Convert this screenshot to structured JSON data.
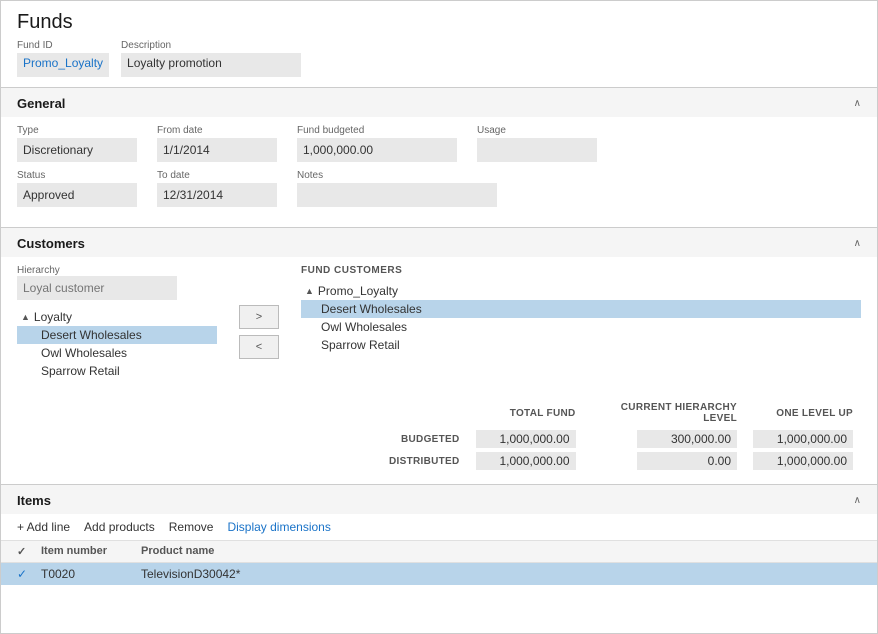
{
  "page": {
    "title": "Funds"
  },
  "fund_header": {
    "fund_id_label": "Fund ID",
    "fund_id_value": "Promo_Loyalty",
    "description_label": "Description",
    "description_value": "Loyalty promotion"
  },
  "general": {
    "section_title": "General",
    "type_label": "Type",
    "type_value": "Discretionary",
    "from_date_label": "From date",
    "from_date_value": "1/1/2014",
    "fund_budgeted_label": "Fund budgeted",
    "fund_budgeted_value": "1,000,000.00",
    "usage_label": "Usage",
    "usage_value": "",
    "status_label": "Status",
    "status_value": "Approved",
    "to_date_label": "To date",
    "to_date_value": "12/31/2014",
    "notes_label": "Notes",
    "notes_value": ""
  },
  "customers": {
    "section_title": "Customers",
    "hierarchy_label": "Hierarchy",
    "hierarchy_placeholder": "Loyal customer",
    "arrow_right": ">",
    "arrow_left": "<",
    "fund_customers_label": "FUND CUSTOMERS",
    "left_tree": [
      {
        "label": "Loyalty",
        "indent": 0,
        "arrow": true,
        "highlighted": false
      },
      {
        "label": "Desert Wholesales",
        "indent": 1,
        "arrow": false,
        "highlighted": true
      },
      {
        "label": "Owl Wholesales",
        "indent": 1,
        "arrow": false,
        "highlighted": false
      },
      {
        "label": "Sparrow Retail",
        "indent": 1,
        "arrow": false,
        "highlighted": false
      }
    ],
    "right_tree": [
      {
        "label": "Promo_Loyalty",
        "indent": 0,
        "arrow": true,
        "highlighted": false
      },
      {
        "label": "Desert Wholesales",
        "indent": 1,
        "arrow": false,
        "highlighted": true
      },
      {
        "label": "Owl Wholesales",
        "indent": 1,
        "arrow": false,
        "highlighted": false
      },
      {
        "label": "Sparrow Retail",
        "indent": 1,
        "arrow": false,
        "highlighted": false
      }
    ]
  },
  "budget": {
    "headers": [
      "",
      "TOTAL FUND",
      "CURRENT HIERARCHY LEVEL",
      "ONE LEVEL UP"
    ],
    "rows": [
      {
        "label": "BUDGETED",
        "total_fund": "1,000,000.00",
        "current_hierarchy": "300,000.00",
        "one_level_up": "1,000,000.00"
      },
      {
        "label": "DISTRIBUTED",
        "total_fund": "1,000,000.00",
        "current_hierarchy": "0.00",
        "one_level_up": "1,000,000.00"
      }
    ]
  },
  "items": {
    "section_title": "Items",
    "add_line_label": "+ Add line",
    "add_products_label": "Add products",
    "remove_label": "Remove",
    "display_dimensions_label": "Display dimensions",
    "check_col": "✓",
    "item_number_col": "Item number",
    "product_name_col": "Product name",
    "rows": [
      {
        "checked": true,
        "item_number": "T0020",
        "product_name": "TelevisionD30042*",
        "highlighted": true
      }
    ]
  },
  "icons": {
    "chevron_up": "∧",
    "chevron_down": "∨",
    "check": "✓"
  }
}
